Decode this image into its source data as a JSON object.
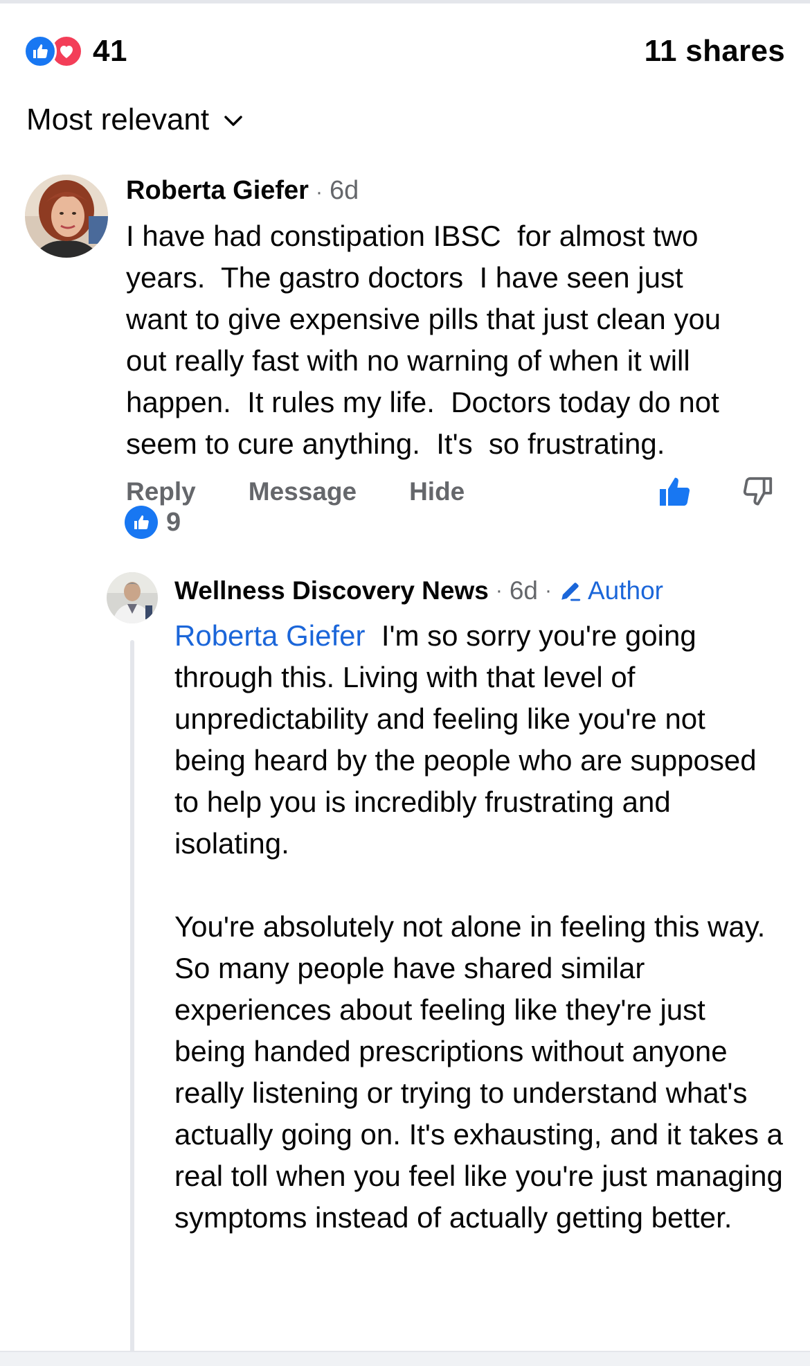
{
  "reactions": {
    "count": "41",
    "types": [
      "like-icon",
      "love-icon"
    ],
    "shares": "11 shares"
  },
  "sort": {
    "label": "Most relevant"
  },
  "comment": {
    "author": "Roberta Giefer",
    "time": "6d",
    "text": "I have had constipation IBSC  for almost two\nyears.  The gastro doctors  I have seen just\nwant to give expensive pills that just clean you\nout really fast with no warning of when it will\nhappen.  It rules my life.  Doctors today do not\nseem to cure anything.  It's  so frustrating.",
    "actions": {
      "reply": "Reply",
      "message": "Message",
      "hide": "Hide"
    },
    "like_count": "9"
  },
  "reply": {
    "author": "Wellness Discovery News",
    "time": "6d",
    "badge": "Author",
    "mention": "Roberta Giefer",
    "paragraph1": "I'm so sorry you're going through this. Living with that level of unpredictability and feeling like you're not being heard by the people who are supposed to help you is incredibly frustrating and isolating.",
    "paragraph2": "You're absolutely not alone in feeling this way. So many people have shared similar experiences about feeling like they're just being handed prescriptions without anyone really listening or trying to understand what's actually going on. It's exhausting, and it takes a real toll when you feel like you're just managing symptoms instead of actually getting better."
  },
  "colors": {
    "accent_blue": "#1877f2",
    "link_blue": "#1b66d9",
    "love_red": "#f33e58",
    "muted_text": "#65676b"
  }
}
